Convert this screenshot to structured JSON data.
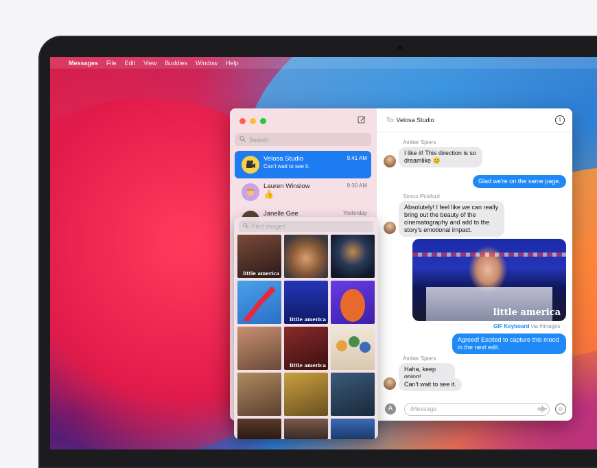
{
  "menubar": {
    "apple": "",
    "items": [
      "Messages",
      "File",
      "Edit",
      "View",
      "Buddies",
      "Window",
      "Help"
    ]
  },
  "sidebar": {
    "search_placeholder": "Search",
    "conversations": [
      {
        "name": "Velosa Studio",
        "preview": "Can't wait to see it.",
        "time": "9:41 AM",
        "selected": true
      },
      {
        "name": "Lauren Winslow",
        "preview": "👍",
        "time": "9:30 AM",
        "selected": false
      },
      {
        "name": "Janelle Gee",
        "preview": "",
        "time": "Yesterday",
        "selected": false
      }
    ]
  },
  "chat": {
    "to_label": "To:",
    "recipient": "Velosa Studio",
    "messages": [
      {
        "sender": "Amber Spiers",
        "text": "I like it! This direction is so dreamlike 😊",
        "dir": "in"
      },
      {
        "text": "Glad we're on the same page.",
        "dir": "out"
      },
      {
        "sender": "Simon Pickford",
        "text": "Absolutely! I feel like we can really bring out the beauty of the cinematography and add to the story's emotional impact.",
        "dir": "in"
      },
      {
        "text": "Agreed! Excited to capture this mood in the next edit.",
        "dir": "out"
      },
      {
        "sender": "Amber Spiers",
        "text": "Haha, keep going!",
        "dir": "in"
      },
      {
        "text": "Can't wait to see it.",
        "dir": "in"
      }
    ],
    "gif_brand": "little america",
    "gif_caption_link": "GIF Keyboard",
    "gif_caption_rest": "via #images",
    "input_placeholder": "iMessage"
  },
  "picker": {
    "search_placeholder": "Find images",
    "tile_brand": "little america"
  },
  "colors": {
    "accent": "#1f8af7",
    "selected_row": "#1e7cf2",
    "incoming_bubble": "#e9e9eb"
  }
}
